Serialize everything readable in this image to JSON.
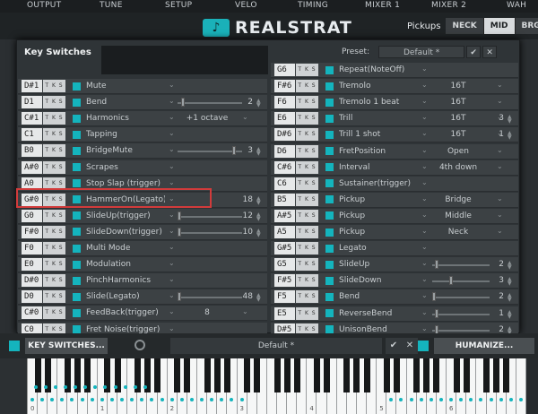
{
  "top_tabs": [
    "OUTPUT",
    "TUNE",
    "SETUP",
    "VELO",
    "TIMING",
    "MIXER 1",
    "MIXER 2",
    "WAH"
  ],
  "app_name": "REALSTRAT",
  "pickups": {
    "label": "Pickups",
    "buttons": [
      "NECK",
      "MID",
      "BRG"
    ],
    "active": "MID"
  },
  "panel": {
    "title": "Key Switches",
    "preset_label": "Preset:",
    "preset_value": "Default *",
    "confirm": "✔",
    "close": "✕"
  },
  "tks": "T K S",
  "left_rows": [
    {
      "key": "D#1",
      "name": "Mute"
    },
    {
      "key": "D1",
      "name": "Bend",
      "slider": 0.05,
      "num": "2"
    },
    {
      "key": "C#1",
      "name": "Harmonics",
      "value": "+1 octave"
    },
    {
      "key": "C1",
      "name": "Tapping"
    },
    {
      "key": "B0",
      "name": "BridgeMute",
      "slider": 0.85,
      "num": "3"
    },
    {
      "key": "A#0",
      "name": "Scrapes"
    },
    {
      "key": "A0",
      "name": "Stop Slap (trigger)"
    },
    {
      "key": "G#0",
      "name": "HammerOn(Legato)",
      "num": "18"
    },
    {
      "key": "G0",
      "name": "SlideUp(trigger)",
      "slider": 0.0,
      "num": "12"
    },
    {
      "key": "F#0",
      "name": "SlideDown(trigger)",
      "slider": 0.0,
      "num": "10"
    },
    {
      "key": "F0",
      "name": "Multi Mode"
    },
    {
      "key": "E0",
      "name": "Modulation"
    },
    {
      "key": "D#0",
      "name": "PinchHarmonics"
    },
    {
      "key": "D0",
      "name": "Slide(Legato)",
      "slider": 0.0,
      "num": "48"
    },
    {
      "key": "C#0",
      "name": "FeedBack(trigger)",
      "value": "8"
    },
    {
      "key": "C0",
      "name": "Fret Noise(trigger)"
    }
  ],
  "right_rows": [
    {
      "key": "G6",
      "name": "Repeat(NoteOff)"
    },
    {
      "key": "F#6",
      "name": "Tremolo",
      "value": "16T"
    },
    {
      "key": "F6",
      "name": "Tremolo 1 beat",
      "value": "16T"
    },
    {
      "key": "E6",
      "name": "Trill",
      "value": "16T",
      "num": "3"
    },
    {
      "key": "D#6",
      "name": "Trill 1 shot",
      "value": "16T",
      "num": "1"
    },
    {
      "key": "D6",
      "name": "FretPosition",
      "value": "Open"
    },
    {
      "key": "C#6",
      "name": "Interval",
      "value": "4th down"
    },
    {
      "key": "C6",
      "name": "Sustainer(trigger)"
    },
    {
      "key": "B5",
      "name": "Pickup",
      "value": "Bridge"
    },
    {
      "key": "A#5",
      "name": "Pickup",
      "value": "Middle"
    },
    {
      "key": "A5",
      "name": "Pickup",
      "value": "Neck"
    },
    {
      "key": "G#5",
      "name": "Legato"
    },
    {
      "key": "G5",
      "name": "SlideUp",
      "slider": 0.05,
      "num": "2"
    },
    {
      "key": "F#5",
      "name": "SlideDown",
      "slider": 0.3,
      "num": "3"
    },
    {
      "key": "F5",
      "name": "Bend",
      "slider": 0.0,
      "num": "2"
    },
    {
      "key": "E5",
      "name": "ReverseBend",
      "slider": 0.05,
      "num": "1"
    },
    {
      "key": "D#5",
      "name": "UnisonBend",
      "slider": 0.05,
      "num": "2"
    }
  ],
  "bottom": {
    "key_switches_btn": "KEY SWITCHES...",
    "preset": "Default *",
    "confirm": "✔",
    "close": "✕",
    "humanize": "HUMANIZE..."
  },
  "octaves": [
    "0",
    "1",
    "2",
    "3",
    "4",
    "5",
    "6"
  ]
}
